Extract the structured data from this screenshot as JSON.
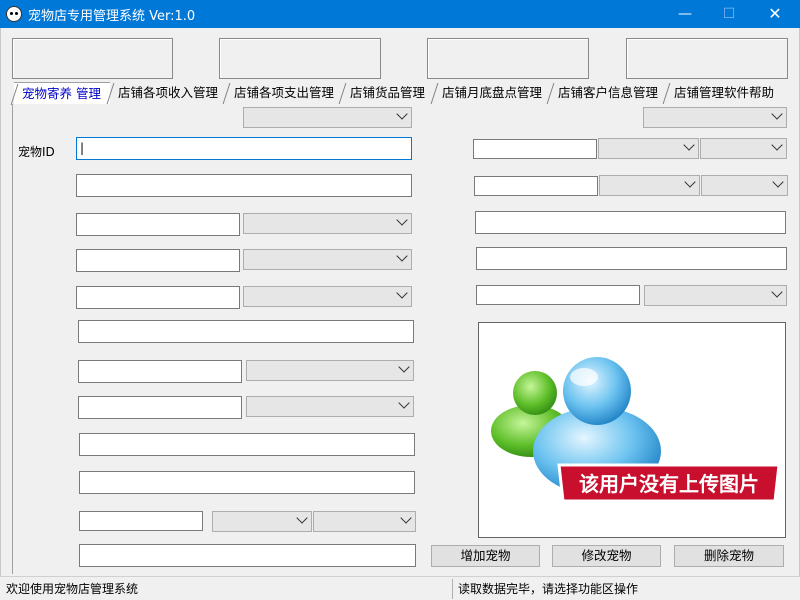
{
  "window": {
    "title": "宠物店专用管理系统  Ver:1.0",
    "minimize_glyph": "—",
    "maximize_glyph": "☐",
    "close_glyph": "✕",
    "accent": "#0078d7"
  },
  "tabs": [
    {
      "label": "宠物寄养 管理",
      "active": true
    },
    {
      "label": "店铺各项收入管理",
      "active": false
    },
    {
      "label": "店铺各项支出管理",
      "active": false
    },
    {
      "label": "店铺货品管理",
      "active": false
    },
    {
      "label": "店铺月底盘点管理",
      "active": false
    },
    {
      "label": "店铺客户信息管理",
      "active": false
    },
    {
      "label": "店铺管理软件帮助",
      "active": false
    }
  ],
  "form": {
    "pet_id_label": "宠物ID",
    "pet_id_value": "|"
  },
  "photo": {
    "caption": "该用户没有上传图片"
  },
  "buttons": {
    "add": "增加宠物",
    "modify": "修改宠物",
    "delete": "删除宠物"
  },
  "status": {
    "left": "欢迎使用宠物店管理系统",
    "right": "读取数据完毕，请选择功能区操作"
  }
}
